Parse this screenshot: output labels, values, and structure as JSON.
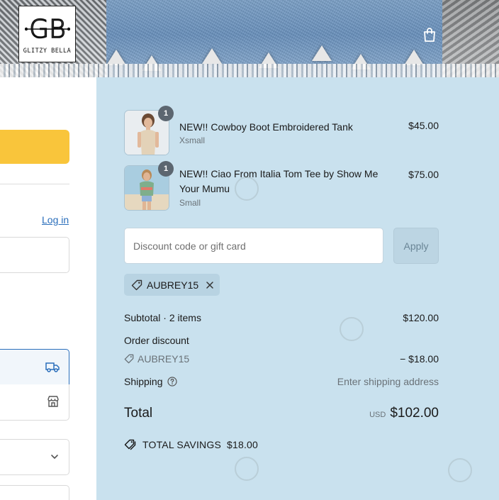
{
  "header": {
    "logo_initials": "GB",
    "logo_text": "GLITZY BELLA"
  },
  "left": {
    "login_link": "Log in"
  },
  "cart": {
    "items": [
      {
        "name": "NEW!! Cowboy Boot Embroidered Tank",
        "variant": "Xsmall",
        "price": "$45.00",
        "quantity": "1"
      },
      {
        "name": "NEW!! Ciao From Italia Tom Tee by Show Me Your Mumu",
        "variant": "Small",
        "price": "$75.00",
        "quantity": "1"
      }
    ]
  },
  "discount": {
    "placeholder": "Discount code or gift card",
    "apply_label": "Apply",
    "applied_code": "AUBREY15"
  },
  "totals": {
    "subtotal_label": "Subtotal · 2 items",
    "subtotal_value": "$120.00",
    "order_discount_label": "Order discount",
    "discount_code": "AUBREY15",
    "discount_value": "− $18.00",
    "shipping_label": "Shipping",
    "shipping_value": "Enter shipping address",
    "total_label": "Total",
    "currency": "USD",
    "total_value": "$102.00",
    "savings_label": "TOTAL SAVINGS",
    "savings_value": "$18.00"
  },
  "colors": {
    "summary_bg": "#c9e1ee",
    "pay_button": "#f9c53b",
    "link": "#2a6ebb"
  }
}
